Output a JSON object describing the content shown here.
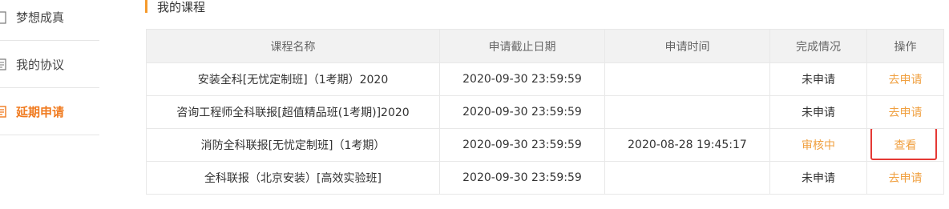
{
  "sidebar": {
    "items": [
      {
        "label": "梦想成真",
        "icon": "book-icon",
        "active": false
      },
      {
        "label": "我的协议",
        "icon": "document-icon",
        "active": false
      },
      {
        "label": "延期申请",
        "icon": "document-icon",
        "active": true
      }
    ]
  },
  "section": {
    "title": "我的课程"
  },
  "table": {
    "headers": [
      "课程名称",
      "申请截止日期",
      "申请时间",
      "完成情况",
      "操作"
    ],
    "rows": [
      {
        "name": "安装全科[无忧定制班]（1考期）2020",
        "deadline": "2020-09-30 23:59:59",
        "applied": "",
        "status": "未申请",
        "action": "去申请"
      },
      {
        "name": "咨询工程师全科联报[超值精品班(1考期)]2020",
        "deadline": "2020-09-30 23:59:59",
        "applied": "",
        "status": "未申请",
        "action": "去申请"
      },
      {
        "name": "消防全科联报[无忧定制班]（1考期）",
        "deadline": "2020-09-30 23:59:59",
        "applied": "2020-08-28 19:45:17",
        "status": "审核中",
        "action": "查看"
      },
      {
        "name": "全科联报（北京安装）[高效实验班]",
        "deadline": "2020-09-30 23:59:59",
        "applied": "",
        "status": "未申请",
        "action": "去申请"
      }
    ]
  },
  "colors": {
    "accent": "#f07a1e",
    "link": "#f0a040",
    "highlight": "#e53935"
  }
}
